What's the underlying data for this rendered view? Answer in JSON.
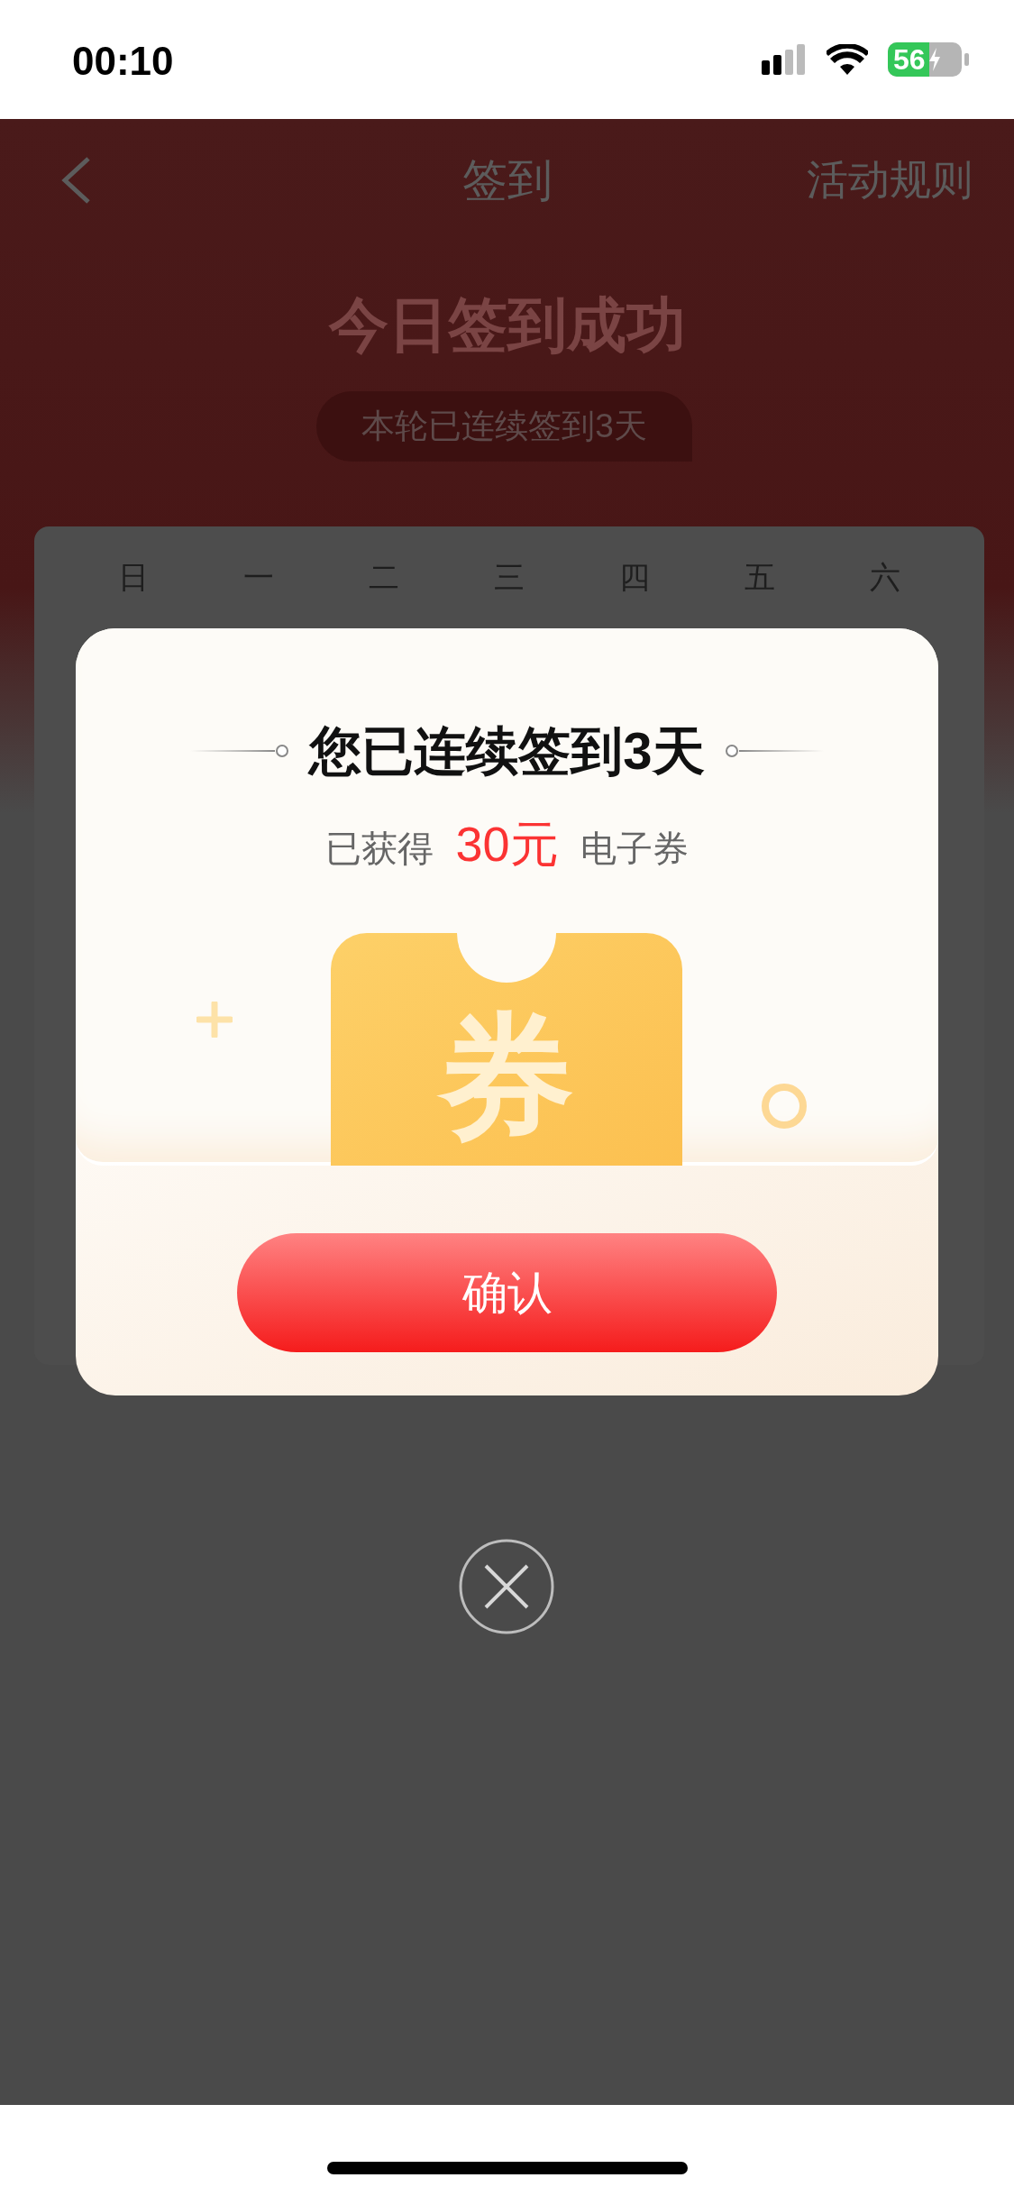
{
  "status_bar": {
    "time": "00:10",
    "battery": "56"
  },
  "nav": {
    "title": "签到",
    "rules_link": "活动规则"
  },
  "banner": {
    "headline": "今日签到成功",
    "streak_pill": "本轮已连续签到3天"
  },
  "calendar": {
    "weekdays": [
      "日",
      "一",
      "二",
      "三",
      "四",
      "五",
      "六"
    ]
  },
  "modal": {
    "title": "您已连续签到3天",
    "reward_prefix": "已获得",
    "reward_amount": "30元",
    "reward_suffix": "电子券",
    "ticket_glyph": "券",
    "confirm_button": "确认"
  }
}
